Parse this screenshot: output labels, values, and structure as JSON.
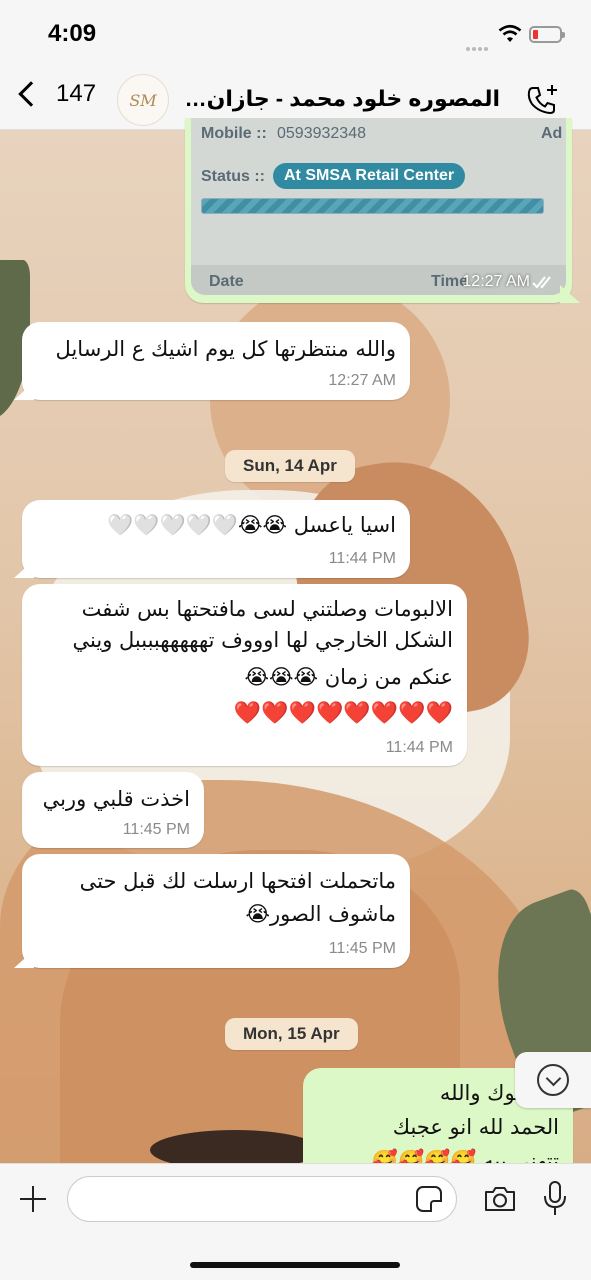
{
  "status_bar": {
    "time": "4:09"
  },
  "header": {
    "back_count": "147",
    "chat_title": "المصوره خلود محمد - جازان المصوره",
    "avatar_text": "SM",
    "back_icon": "chevron-left-icon",
    "call_icon": "phone-plus-icon"
  },
  "image_message": {
    "mobile_label": "Mobile ::",
    "mobile_value": "0593932348",
    "ad_fragment": "Ad",
    "status_label": "Status ::",
    "status_value": "At SMSA Retail Center",
    "date_label": "Date",
    "time_fragment": "Time",
    "time": "12:27 AM"
  },
  "messages": [
    {
      "text": "والله منتظرتها كل يوم اشيك ع الرسايل",
      "time": "12:27 AM"
    },
    {
      "text": "اسيا ياعسل 😭😭🤍🤍🤍🤍🤍",
      "time": "11:44 PM"
    },
    {
      "line1": "الالبومات وصلتني لسى مافتحتها بس شفت",
      "line2": "الشكل الخارجي لها اوووف تهههههببببل ويني",
      "line3": "عنكم من زمان 😭😭😭",
      "line4": "❤️❤️❤️❤️❤️❤️❤️❤️",
      "time": "11:44 PM"
    },
    {
      "text": "اخذت قلبي وربي",
      "time": "11:45 PM"
    },
    {
      "line1": "ماتحملت افتحها ارسلت لك قبل حتى",
      "line2": "ماشوف الصور😭",
      "time": "11:45 PM"
    },
    {
      "line1": "تسلموك والله",
      "line2": "الحمد لله انو عجبك",
      "line3": "تتهني بيه 🥰🥰🥰🥰"
    }
  ],
  "dates": {
    "d1": "Sun, 14 Apr",
    "d2": "Mon, 15 Apr"
  },
  "composer": {
    "placeholder": ""
  },
  "colors": {
    "incoming": "#ffffff",
    "outgoing": "#dcf8c6",
    "date_chip": "#f5e5cf"
  }
}
